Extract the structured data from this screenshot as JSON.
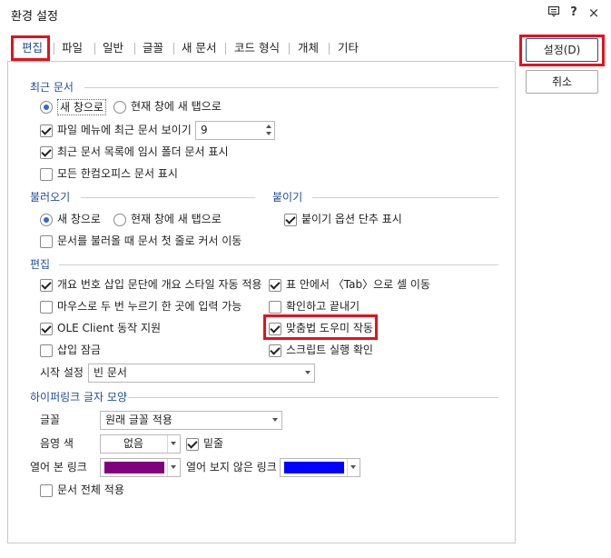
{
  "window": {
    "title": "환경 설정",
    "help_label": "?",
    "close_label": "×"
  },
  "tabs": [
    {
      "label": "편집"
    },
    {
      "label": "파일"
    },
    {
      "label": "일반"
    },
    {
      "label": "글꼴"
    },
    {
      "label": "새 문서"
    },
    {
      "label": "코드 형식"
    },
    {
      "label": "개체"
    },
    {
      "label": "기타"
    }
  ],
  "buttons": {
    "ok": "설정(D)",
    "cancel": "취소"
  },
  "recent": {
    "header": "최근 문서",
    "radio_new_window": "새 창으로",
    "radio_new_tab": "현재 창에 새 탭으로",
    "show_in_menu": "파일 메뉴에 최근 문서 보이기",
    "count": "9",
    "temp_folder": "최근 문서 목록에 임시 폴더 문서 표시",
    "all_hancom": "모든 한컴오피스 문서 표시"
  },
  "open": {
    "header": "불러오기",
    "radio_new_window": "새 창으로",
    "radio_new_tab": "현재 창에 새 탭으로",
    "cursor_first_line": "문서를 불러올 때 문서 첫 줄로 커서 이동"
  },
  "paste": {
    "header": "붙이기",
    "shortcut": "붙이기 옵션 단추 표시"
  },
  "edit": {
    "header": "편집",
    "outline_style": "개요 번호 삽입 문단에 개요 스타일 자동 적용",
    "tab_cell": "표 안에서 〈Tab〉으로 셀 이동",
    "double_click": "마우스로 두 번 누르기 한 곳에 입력 가능",
    "confirm_close": "확인하고 끝내기",
    "ole_client": "OLE Client 동작 지원",
    "spell_helper": "맞춤법 도우미 작동",
    "insert_lock": "삽입 잠금",
    "script_run": "스크립트 실행 확인",
    "start_label": "시작 설정",
    "start_value": "빈 문서"
  },
  "hyperlink": {
    "header": "하이퍼링크 글자 모양",
    "font_label": "글꼴",
    "font_value": "원래 글꼴 적용",
    "shade_label": "음영 색",
    "shade_value": "없음",
    "underline": "밑줄",
    "visited_label": "열어 본 링크",
    "visited_color": "#800080",
    "unvisited_label": "열어 보지 않은 링크",
    "unvisited_color": "#0000ff",
    "apply_all": "문서 전체 적용"
  },
  "colors": {
    "accent": "#1f4e99",
    "highlight": "#e8101a",
    "radio": "#2b6bd6"
  }
}
